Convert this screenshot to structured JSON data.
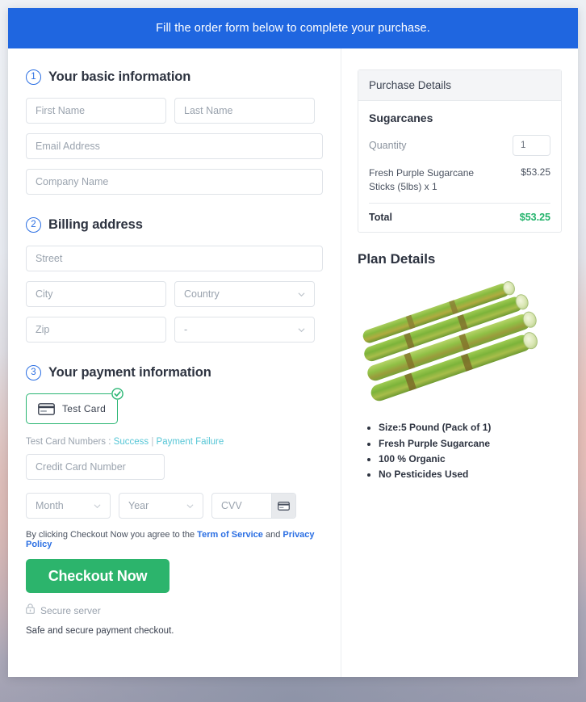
{
  "banner": {
    "text": "Fill the order form below to complete your purchase."
  },
  "steps": {
    "basic": {
      "num": "1",
      "title": "Your basic information"
    },
    "billing": {
      "num": "2",
      "title": "Billing address"
    },
    "payment": {
      "num": "3",
      "title": "Your payment information"
    }
  },
  "fields": {
    "first_name": "First Name",
    "last_name": "Last Name",
    "email": "Email Address",
    "company": "Company Name",
    "street": "Street",
    "city": "City",
    "country": "Country",
    "zip": "Zip",
    "state": "-",
    "credit_card": "Credit Card Number",
    "month": "Month",
    "year": "Year",
    "cvv": "CVV"
  },
  "payment": {
    "tile_label": "Test Card",
    "tile_icon": "credit-card-icon",
    "tile_check_icon": "check-circle-icon",
    "test_prefix": "Test Card Numbers :",
    "test_success": "Success",
    "test_separator": "|",
    "test_failure": "Payment Failure",
    "cvv_icon": "credit-card-icon"
  },
  "agreement": {
    "prefix": "By clicking Checkout Now you agree to the",
    "terms": "Term of Service",
    "and": "and",
    "privacy": "Privacy Policy"
  },
  "checkout": {
    "button": "Checkout Now",
    "secure_icon": "lock-icon",
    "secure_label": "Secure server",
    "safe_note": "Safe and secure payment checkout."
  },
  "purchase": {
    "heading": "Purchase Details",
    "product": "Sugarcanes",
    "quantity_label": "Quantity",
    "quantity_value": "1",
    "line_item": "Fresh Purple Sugarcane Sticks (5lbs) x 1",
    "line_amount": "$53.25",
    "total_label": "Total",
    "total_amount": "$53.25"
  },
  "plan": {
    "title": "Plan Details",
    "image_name": "sugarcane-product-image",
    "bullets": [
      "Size:5 Pound (Pack of 1)",
      "Fresh Purple Sugarcane",
      "100 % Organic",
      "No Pesticides Used"
    ]
  },
  "colors": {
    "banner_blue": "#1f66e0",
    "step_blue": "#2b6fe3",
    "checkout_green": "#2cb46c",
    "total_green": "#23b36b",
    "tile_green": "#2ab673",
    "link_cyan": "#56c6d6"
  }
}
